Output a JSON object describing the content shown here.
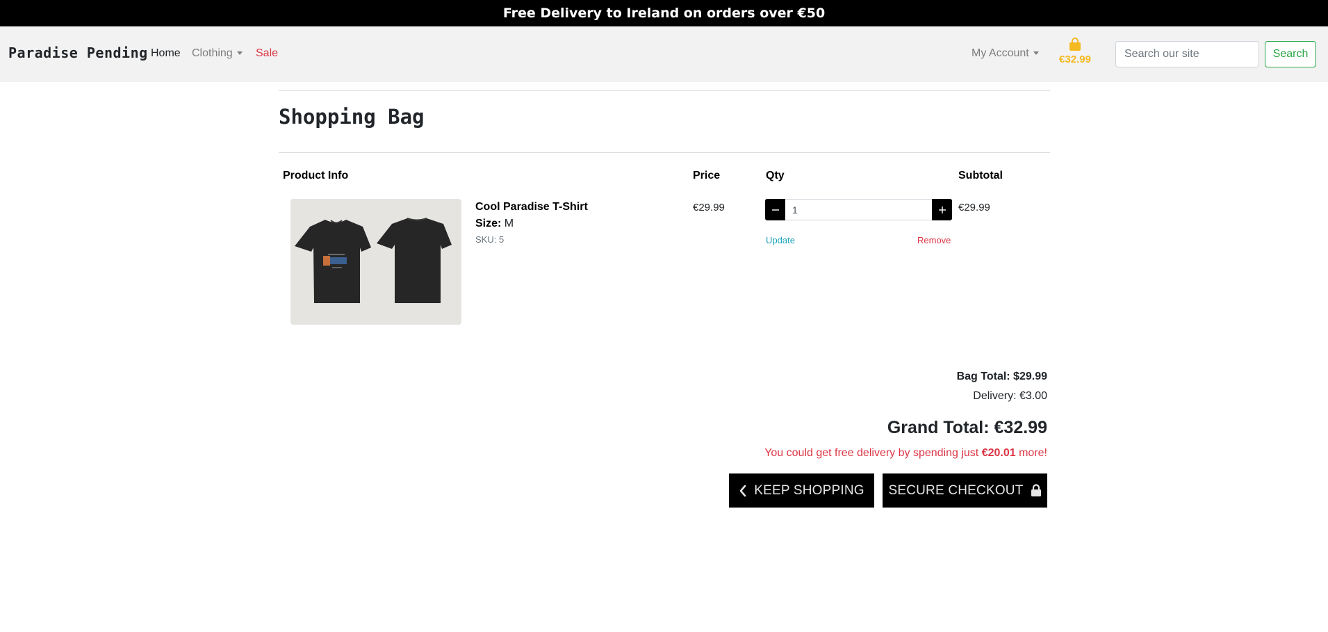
{
  "banner": {
    "text": "Free Delivery to Ireland on orders over €50"
  },
  "navbar": {
    "brand": "Paradise Pending",
    "links": {
      "home": "Home",
      "clothing": "Clothing",
      "sale": "Sale"
    },
    "account": "My Account",
    "bag_total": "€32.99",
    "search": {
      "placeholder": "Search our site",
      "button": "Search"
    }
  },
  "page": {
    "title": "Shopping Bag"
  },
  "table": {
    "headers": {
      "product": "Product Info",
      "price": "Price",
      "qty": "Qty",
      "subtotal": "Subtotal"
    },
    "rows": [
      {
        "name": "Cool Paradise T-Shirt",
        "size_label": "Size:",
        "size": "M",
        "sku": "SKU: 5",
        "price": "€29.99",
        "qty": "1",
        "subtotal": "€29.99",
        "update": "Update",
        "remove": "Remove"
      }
    ]
  },
  "summary": {
    "bag_total": "Bag Total: $29.99",
    "delivery": "Delivery: €3.00",
    "grand_total": "Grand Total: €32.99",
    "free_delivery_prefix": "You could get free delivery by spending just",
    "free_delivery_amount": "€20.01",
    "free_delivery_suffix": "more!"
  },
  "buttons": {
    "keep_shopping": "KEEP SHOPPING",
    "secure_checkout": "SECURE CHECKOUT"
  },
  "colors": {
    "accent_bag": "#f5b921",
    "sale": "#dc3545",
    "search": "#28a745",
    "update": "#17a2b8"
  }
}
